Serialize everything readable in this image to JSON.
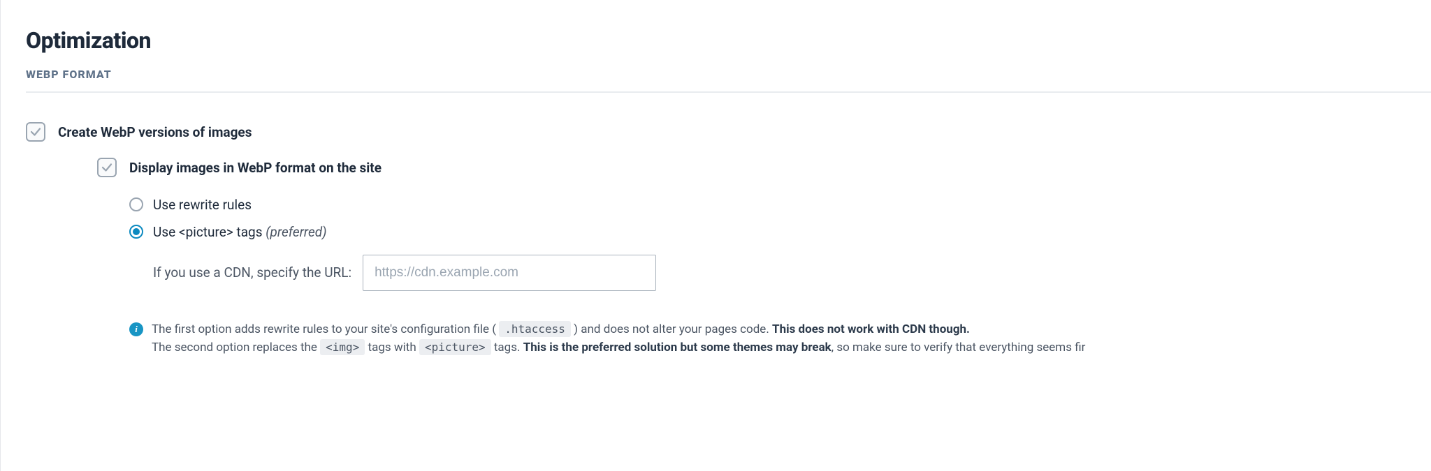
{
  "title": "Optimization",
  "section_subtitle": "WEBP FORMAT",
  "webp": {
    "create_label": "Create WebP versions of images",
    "display_label": "Display images in WebP format on the site",
    "radio": {
      "rewrite": "Use rewrite rules",
      "picture_prefix": "Use <picture> tags ",
      "picture_suffix": "(preferred)"
    },
    "cdn": {
      "label": "If you use a CDN, specify the URL:",
      "placeholder": "https://cdn.example.com",
      "value": ""
    },
    "info": {
      "part1a": "The first option adds rewrite rules to your site's configuration file ( ",
      "code1": ".htaccess",
      "part1b": " ) and does not alter your pages code. ",
      "strong1": "This does not work with CDN though.",
      "part2a": "The second option replaces the ",
      "code2": "<img>",
      "part2b": " tags with ",
      "code3": "<picture>",
      "part2c": " tags. ",
      "strong2": "This is the preferred solution but some themes may break",
      "part2d": ", so make sure to verify that everything seems fir"
    }
  }
}
